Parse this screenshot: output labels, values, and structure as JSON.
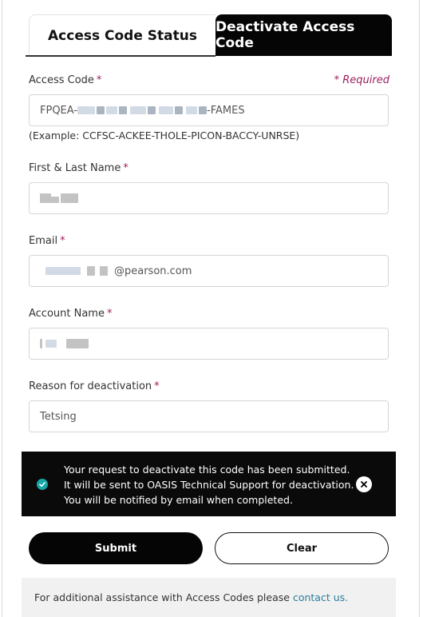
{
  "tabs": {
    "status_label": "Access Code Status",
    "deactivate_label": "Deactivate Access Code"
  },
  "form": {
    "required_note": "* Required",
    "required_star": "*",
    "access_code": {
      "label": "Access Code",
      "value_prefix": "FPQEA-",
      "value_suffix": "-FAMES",
      "example": "(Example: CCFSC-ACKEE-THOLE-PICON-BACCY-UNRSE)"
    },
    "name": {
      "label": "First & Last Name"
    },
    "email": {
      "label": "Email",
      "value_suffix": "@pearson.com"
    },
    "account": {
      "label": "Account Name"
    },
    "reason": {
      "label": "Reason for deactivation",
      "value": "Tetsing"
    }
  },
  "toast": {
    "lines": [
      "Your request to deactivate this code has been submitted.",
      "It will be sent to OASIS Technical Support for deactivation.",
      "You will be notified by email when completed."
    ],
    "icon": "check-circle-icon",
    "close_icon": "close-circle-icon"
  },
  "buttons": {
    "submit": "Submit",
    "clear": "Clear"
  },
  "footer": {
    "text": "For additional assistance with Access Codes please",
    "link": "contact us."
  },
  "colors": {
    "accent_magenta": "#9e1f5e",
    "tab_active_bg": "#050505",
    "toast_bg": "#0a0a0a",
    "check_teal": "#17a7a8",
    "link": "#2a7d9c"
  }
}
